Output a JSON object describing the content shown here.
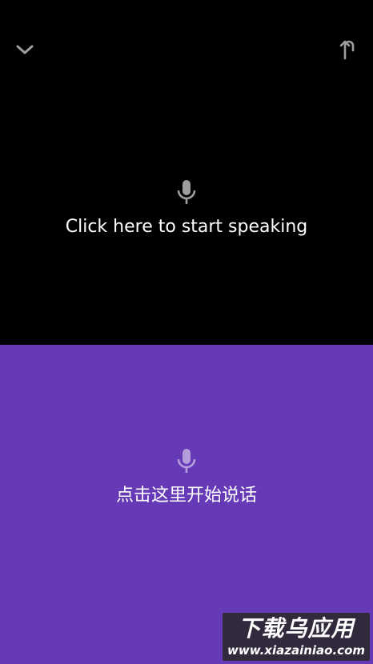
{
  "top_panel": {
    "prompt": "Click here to start speaking",
    "background": "#000000",
    "icons": {
      "left": "chevron-down-icon",
      "right": "rotate-icon",
      "center": "microphone-icon"
    }
  },
  "bottom_panel": {
    "prompt": "点击这里开始说话",
    "background": "#663ab7",
    "icons": {
      "center": "microphone-icon"
    }
  },
  "watermark": {
    "title": "下载乌应用",
    "url": "www.xiazainiao.com"
  }
}
